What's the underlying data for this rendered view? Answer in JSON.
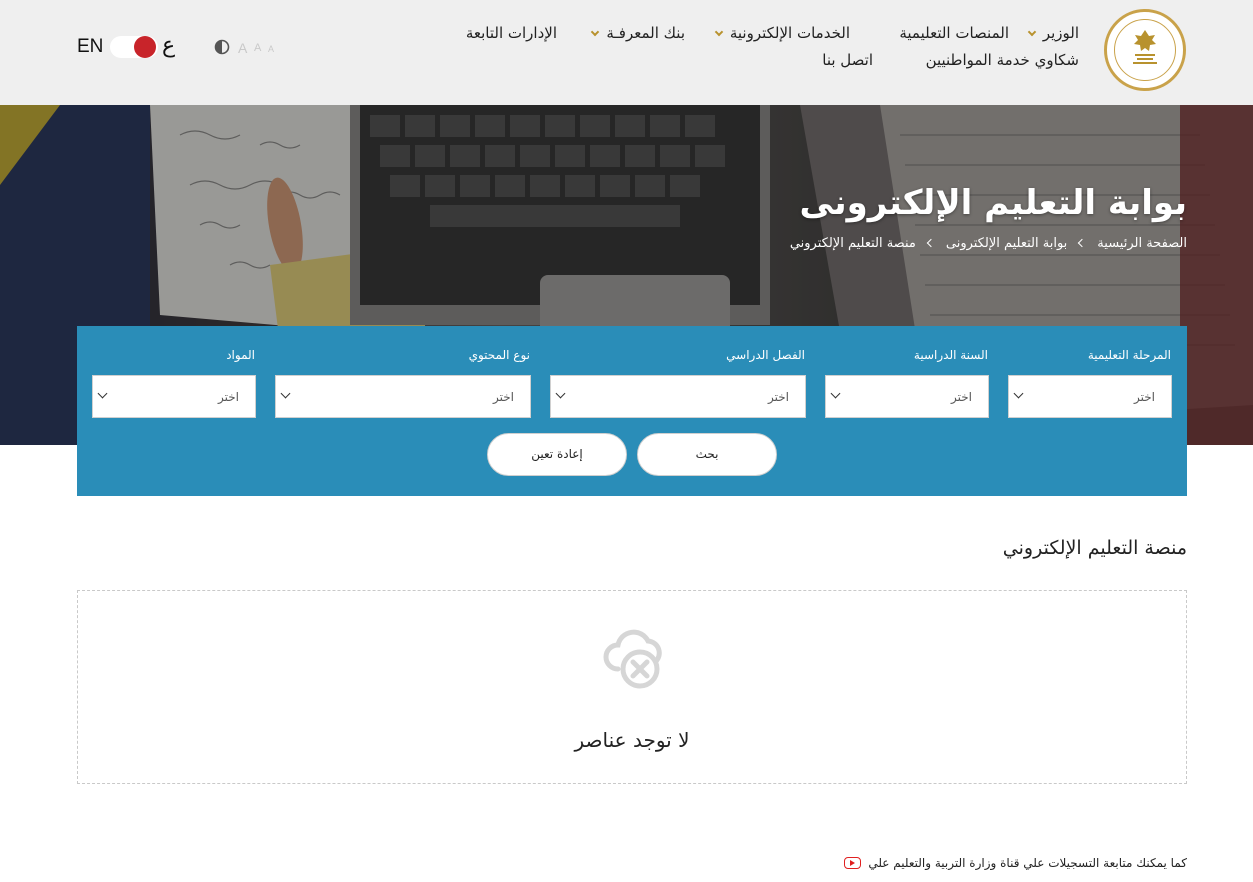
{
  "header": {
    "nav_row1": [
      {
        "label": "الوزير",
        "has_dropdown": true
      },
      {
        "label": "المنصات التعليمية",
        "has_dropdown": false
      },
      {
        "label": "الخدمات الإلكترونية",
        "has_dropdown": true
      },
      {
        "label": "بنك المعرفـة",
        "has_dropdown": true
      },
      {
        "label": "الإدارات التابعة",
        "has_dropdown": false
      }
    ],
    "nav_row2": [
      {
        "label": "شكاوي خدمة المواطنيين"
      },
      {
        "label": "اتصل بنا"
      }
    ],
    "lang_en": "EN",
    "lang_ar": "ع",
    "font_sizes": [
      "A",
      "A",
      "A"
    ]
  },
  "hero": {
    "title": "بوابة التعليم الإلكترونى",
    "breadcrumb": [
      "الصفحة الرئيسية",
      "بوابة التعليم الإلكترونى",
      "منصة التعليم الإلكتروني"
    ]
  },
  "filter": {
    "fields": [
      {
        "label": "المرحلة التعليمية",
        "value": "اختر"
      },
      {
        "label": "السنة الدراسية",
        "value": "اختر"
      },
      {
        "label": "الفصل الدراسي",
        "value": "اختر"
      },
      {
        "label": "نوع المحتوي",
        "value": "اختر"
      },
      {
        "label": "المواد",
        "value": "اختر"
      }
    ],
    "search_label": "بحث",
    "reset_label": "إعادة تعين"
  },
  "content": {
    "section_title": "منصة التعليم الإلكتروني",
    "empty_message": "لا توجد عناصر"
  },
  "footer": {
    "note": "كما يمكنك متابعة التسجيلات علي قناة وزارة التربية والتعليم علي"
  },
  "colors": {
    "header_bg": "#efefef",
    "filter_bg": "#2a8db8",
    "accent_gold": "#b8922e",
    "toggle_red": "#c8242a"
  },
  "icons": [
    "ministry-logo-icon",
    "chevron-down-icon",
    "contrast-icon",
    "no-items-cloud-icon",
    "youtube-icon"
  ]
}
